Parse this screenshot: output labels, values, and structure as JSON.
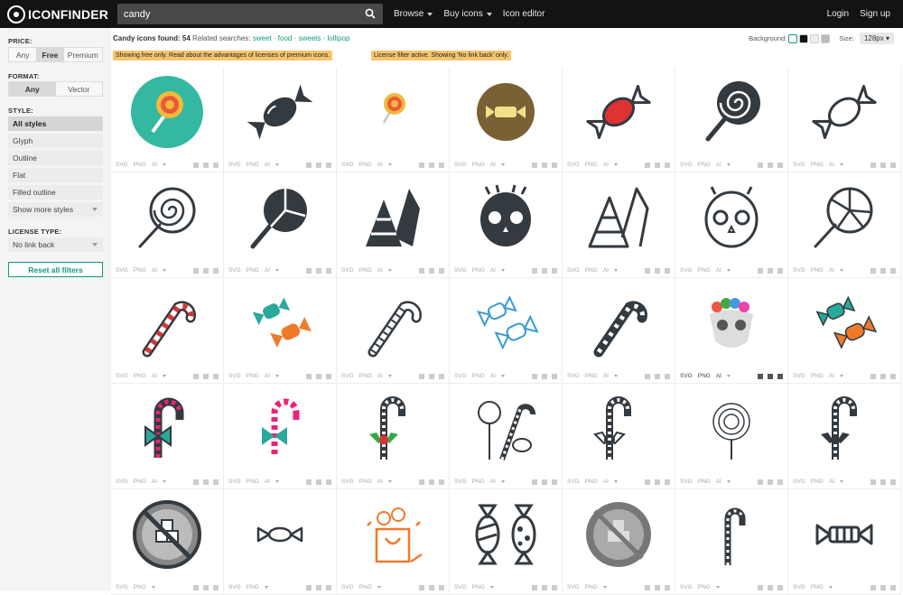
{
  "header": {
    "logo_text": "ICONFINDER",
    "search_value": "candy",
    "nav": [
      "Browse",
      "Buy icons",
      "Icon editor"
    ],
    "login": "Login",
    "signup": "Sign up"
  },
  "sidebar": {
    "price_label": "PRICE:",
    "price_options": [
      "Any",
      "Free",
      "Premium"
    ],
    "format_label": "FORMAT:",
    "format_options": [
      "Any",
      "Vector"
    ],
    "style_label": "STYLE:",
    "styles": [
      "All styles",
      "Glyph",
      "Outline",
      "Flat",
      "Filled outline",
      "Show more styles"
    ],
    "license_label": "LICENSE TYPE:",
    "license_value": "No link back",
    "reset_label": "Reset all filters"
  },
  "results": {
    "prefix": "Candy icons found:",
    "count": "54",
    "related_label": "Related searches:",
    "related": [
      "sweet",
      "food",
      "sweets",
      "lollipop"
    ],
    "notice_free": "Showing free only. Read about the advantages of licenses of premium icons.",
    "notice_license": "License filter active. Showing 'No link back' only.",
    "background_label": "Background:",
    "size_label": "Size:",
    "size_value": "128px"
  },
  "formats": {
    "svg": "SVG",
    "png": "PNG",
    "ai": "AI"
  },
  "colors": {
    "accent": "#15977d",
    "notice": "#f6c56c",
    "topbar": "#131313"
  },
  "icons": [
    "lollipop-flat-teal-icon",
    "wrapped-candy-glyph-icon",
    "lollipop-flat-small-icon",
    "wrapped-candy-circle-icon",
    "wrapped-candy-red-icon",
    "lollipop-swirl-glyph-icon",
    "wrapped-candy-outline-icon",
    "lollipop-swirl-outline-icon",
    "lollipop-glyph-icon",
    "candy-corn-glyph-icon",
    "sugar-skull-glyph-icon",
    "candy-corn-outline-icon",
    "sugar-skull-outline-icon",
    "lollipop-outline-icon",
    "candy-cane-red-icon",
    "wrapped-candy-teal-icon",
    "candy-cane-outline-icon",
    "wrapped-candy-blue-outline-icon",
    "candy-cane-glyph-icon",
    "candy-skull-flat-icon",
    "wrapped-candy-teal-orange-icon",
    "candy-cane-bow-icon",
    "candy-cane-bow-flat-icon",
    "candy-cane-holly-icon",
    "lollipop-cane-outline-icon",
    "candy-cane-holly-outline-icon",
    "lollipop-sketch-icon",
    "candy-cane-holly-glyph-icon",
    "no-sugar-icon",
    "wrapped-candy-small-icon",
    "candy-bag-icon",
    "wrapped-candies-pair-icon",
    "no-sugar-gray-icon",
    "candy-cane-thin-icon",
    "wrapped-candy-long-icon"
  ]
}
